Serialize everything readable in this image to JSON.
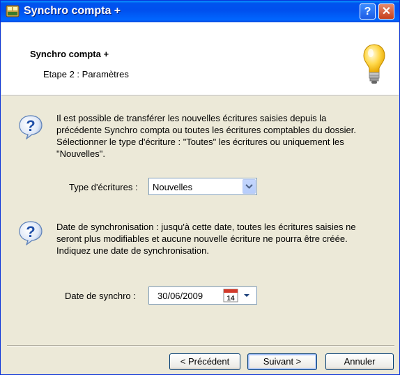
{
  "window": {
    "title": "Synchro compta +"
  },
  "header": {
    "title": "Synchro compta +",
    "subtitle": "Etape 2 : Paramètres"
  },
  "section1": {
    "lines": [
      "Il est possible de transférer les nouvelles écritures saisies depuis la",
      "précédente Synchro compta ou toutes les écritures comptables du dossier.",
      "Sélectionner le type d'écriture : \"Toutes\" les écritures ou uniquement les",
      "\"Nouvelles\"."
    ],
    "field_label": "Type d'écritures :",
    "field_value": "Nouvelles"
  },
  "section2": {
    "lines": [
      "Date de synchronisation : jusqu'à cette date, toutes les écritures saisies ne",
      "seront plus modifiables et aucune nouvelle écriture ne pourra être créée.",
      "Indiquez une date de synchronisation."
    ],
    "field_label": "Date de synchro :",
    "field_value": "30/06/2009",
    "calendar_day": "14"
  },
  "buttons": {
    "prev": "< Précédent",
    "next": "Suivant >",
    "cancel": "Annuler"
  },
  "titlebar_buttons": {
    "help": "?",
    "close": "✕"
  },
  "icons": {
    "app": "app-icon",
    "bulb": "lightbulb-icon",
    "question": "question-icon",
    "calendar": "calendar-icon",
    "dropdown": "chevron-down-icon"
  }
}
